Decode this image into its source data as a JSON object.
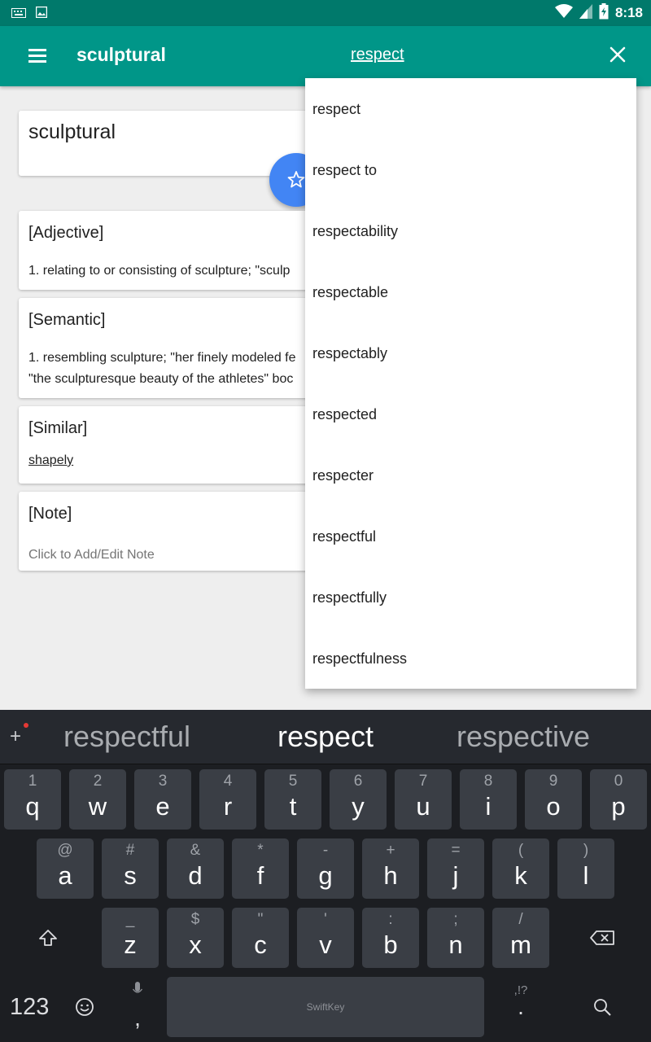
{
  "status_bar": {
    "time": "8:18"
  },
  "app_bar": {
    "title": "sculptural",
    "search_value": "respect"
  },
  "word_card": {
    "word": "sculptural"
  },
  "adjective_card": {
    "heading": "[Adjective]",
    "definition": "1. relating to or consisting of sculpture; \"sculp"
  },
  "semantic_card": {
    "heading": "[Semantic]",
    "line1": "1. resembling sculpture; \"her finely modeled fe",
    "line2": "\"the sculpturesque beauty of the athletes\" boc"
  },
  "similar_card": {
    "heading": "[Similar]",
    "link": "shapely"
  },
  "note_card": {
    "heading": "[Note]",
    "placeholder": "Click to Add/Edit Note"
  },
  "suggestions": [
    "respect",
    "respect to",
    "respectability",
    "respectable",
    "respectably",
    "respected",
    "respecter",
    "respectful",
    "respectfully",
    "respectfulness"
  ],
  "keyboard": {
    "predictions": {
      "left": "respectful",
      "center": "respect",
      "right": "respective"
    },
    "row1": [
      {
        "hint": "1",
        "char": "q"
      },
      {
        "hint": "2",
        "char": "w"
      },
      {
        "hint": "3",
        "char": "e"
      },
      {
        "hint": "4",
        "char": "r"
      },
      {
        "hint": "5",
        "char": "t"
      },
      {
        "hint": "6",
        "char": "y"
      },
      {
        "hint": "7",
        "char": "u"
      },
      {
        "hint": "8",
        "char": "i"
      },
      {
        "hint": "9",
        "char": "o"
      },
      {
        "hint": "0",
        "char": "p"
      }
    ],
    "row2": [
      {
        "hint": "@",
        "char": "a"
      },
      {
        "hint": "#",
        "char": "s"
      },
      {
        "hint": "&",
        "char": "d"
      },
      {
        "hint": "*",
        "char": "f"
      },
      {
        "hint": "-",
        "char": "g"
      },
      {
        "hint": "+",
        "char": "h"
      },
      {
        "hint": "=",
        "char": "j"
      },
      {
        "hint": "(",
        "char": "k"
      },
      {
        "hint": ")",
        "char": "l"
      }
    ],
    "row3": [
      {
        "hint": "_",
        "char": "z"
      },
      {
        "hint": "$",
        "char": "x"
      },
      {
        "hint": "\"",
        "char": "c"
      },
      {
        "hint": "'",
        "char": "v"
      },
      {
        "hint": ":",
        "char": "b"
      },
      {
        "hint": ";",
        "char": "n"
      },
      {
        "hint": "/",
        "char": "m"
      }
    ],
    "numbers_label": "123",
    "comma": ",",
    "brand": "SwiftKey",
    "punct_hint": ",!?",
    "period": "."
  }
}
